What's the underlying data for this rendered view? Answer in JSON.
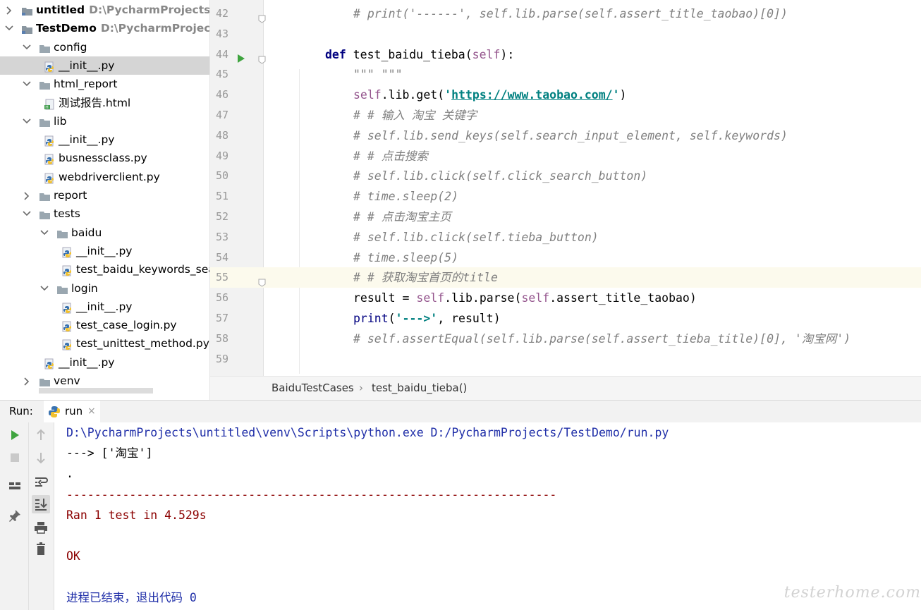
{
  "project_tree": {
    "rows": [
      {
        "label": "untitled",
        "path": "D:\\PycharmProjects\\untitled",
        "bold": true,
        "expanded": false
      },
      {
        "label": "TestDemo",
        "path": "D:\\PycharmProjects\\TestDemo",
        "bold": true,
        "expanded": true
      },
      {
        "label": "config",
        "expanded": true
      },
      {
        "label": "__init__.py"
      },
      {
        "label": "html_report",
        "expanded": true
      },
      {
        "label": "测试报告.html"
      },
      {
        "label": "lib",
        "expanded": true
      },
      {
        "label": "__init__.py"
      },
      {
        "label": "busnessclass.py"
      },
      {
        "label": "webdriverclient.py"
      },
      {
        "label": "report",
        "expanded": false
      },
      {
        "label": "tests",
        "expanded": true
      },
      {
        "label": "baidu",
        "expanded": true
      },
      {
        "label": "__init__.py"
      },
      {
        "label": "test_baidu_keywords_search.py"
      },
      {
        "label": "login",
        "expanded": true
      },
      {
        "label": "__init__.py"
      },
      {
        "label": "test_case_login.py"
      },
      {
        "label": "test_unittest_method.py"
      },
      {
        "label": "__init__.py"
      },
      {
        "label": "venv",
        "expanded": false
      }
    ]
  },
  "editor": {
    "lines": [
      {
        "n": "42",
        "segs": [
          [
            "cm",
            "# print('------', self.lib.parse(self.assert_title_taobao)[0])"
          ]
        ]
      },
      {
        "n": "43",
        "segs": []
      },
      {
        "n": "44",
        "segs": [
          [
            "kw",
            "def "
          ],
          [
            "pl",
            "test_baidu_tieba("
          ],
          [
            "slf",
            "self"
          ],
          [
            "pl",
            "):"
          ]
        ]
      },
      {
        "n": "45",
        "segs": [
          [
            "docq",
            "\"\"\" \"\"\""
          ]
        ]
      },
      {
        "n": "46",
        "segs": [
          [
            "slf",
            "self"
          ],
          [
            "pl",
            ".lib.get("
          ],
          [
            "st",
            "'"
          ],
          [
            "url",
            "https://www.taobao.com/"
          ],
          [
            "st",
            "'"
          ],
          [
            "pl",
            ")"
          ]
        ]
      },
      {
        "n": "47",
        "segs": [
          [
            "cm",
            "# # 输入 淘宝 关键字"
          ]
        ]
      },
      {
        "n": "48",
        "segs": [
          [
            "cm",
            "# self.lib.send_keys(self.search_input_element, self.keywords)"
          ]
        ]
      },
      {
        "n": "49",
        "segs": [
          [
            "cm",
            "# # 点击搜索"
          ]
        ]
      },
      {
        "n": "50",
        "segs": [
          [
            "cm",
            "# self.lib.click(self.click_search_button)"
          ]
        ]
      },
      {
        "n": "51",
        "segs": [
          [
            "cm",
            "# time.sleep(2)"
          ]
        ]
      },
      {
        "n": "52",
        "segs": [
          [
            "cm",
            "# # 点击淘宝主页"
          ]
        ]
      },
      {
        "n": "53",
        "segs": [
          [
            "cm",
            "# self.lib.click(self.tieba_button)"
          ]
        ]
      },
      {
        "n": "54",
        "segs": [
          [
            "cm",
            "# time.sleep(5)"
          ]
        ]
      },
      {
        "n": "55",
        "segs": [
          [
            "cm",
            "# # 获取淘宝首页的title"
          ]
        ]
      },
      {
        "n": "56",
        "segs": [
          [
            "pl",
            "result = "
          ],
          [
            "slf",
            "self"
          ],
          [
            "pl",
            ".lib.parse("
          ],
          [
            "slf",
            "self"
          ],
          [
            "pl",
            ".assert_title_taobao)"
          ]
        ]
      },
      {
        "n": "57",
        "segs": [
          [
            "blt",
            "print"
          ],
          [
            "pl",
            "("
          ],
          [
            "st",
            "'--->'"
          ],
          [
            "pl",
            ", result)"
          ]
        ]
      },
      {
        "n": "58",
        "segs": [
          [
            "cm",
            "# self.assertEqual(self.lib.parse(self.assert_tieba_title)[0], '淘宝网')"
          ]
        ]
      },
      {
        "n": "59",
        "segs": []
      }
    ],
    "current_line": "55"
  },
  "breadcrumb": {
    "class_name": "BaiduTestCases",
    "method_name": "test_baidu_tieba()",
    "separator": "›"
  },
  "run_panel": {
    "title": "Run:",
    "tab_label": "run",
    "tab_close": "×",
    "console": [
      {
        "text": "D:\\PycharmProjects\\untitled\\venv\\Scripts\\python.exe D:/PycharmProjects/TestDemo/run.py",
        "color": "blue"
      },
      {
        "text": "---> ['淘宝']",
        "color": "black"
      },
      {
        "text": ".",
        "color": "black"
      },
      {
        "text": "----------------------------------------------------------------------",
        "color": "red"
      },
      {
        "text": "Ran 1 test in 4.529s",
        "color": "red"
      },
      {
        "text": "",
        "color": "red"
      },
      {
        "text": "OK",
        "color": "red"
      },
      {
        "text": "",
        "color": "black"
      },
      {
        "text": "进程已结束，退出代码 0",
        "color": "blue"
      }
    ]
  },
  "watermark": "testerhome.com"
}
